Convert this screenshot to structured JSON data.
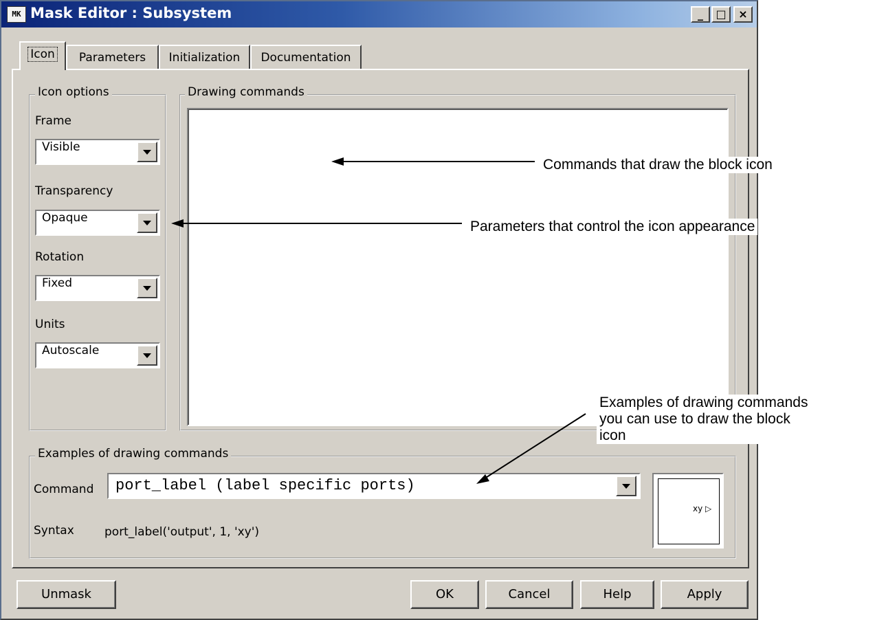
{
  "window": {
    "title": "Mask Editor : Subsystem",
    "icon_text": "MK",
    "caption_buttons": [
      "_",
      "□",
      "×"
    ]
  },
  "tabs": [
    {
      "label": "Icon",
      "active": true
    },
    {
      "label": "Parameters",
      "active": false
    },
    {
      "label": "Initialization",
      "active": false
    },
    {
      "label": "Documentation",
      "active": false
    }
  ],
  "icon_options": {
    "legend": "Icon options",
    "fields": [
      {
        "label": "Frame",
        "value": "Visible"
      },
      {
        "label": "Transparency",
        "value": "Opaque"
      },
      {
        "label": "Rotation",
        "value": "Fixed"
      },
      {
        "label": "Units",
        "value": "Autoscale"
      }
    ]
  },
  "drawing_commands": {
    "legend": "Drawing commands",
    "value": ""
  },
  "examples": {
    "legend": "Examples of drawing commands",
    "command_label": "Command",
    "command_value": "port_label (label specific ports)",
    "syntax_label": "Syntax",
    "syntax_value": "port_label('output', 1, 'xy')",
    "preview_port_label": "xy"
  },
  "buttons": {
    "unmask": "Unmask",
    "ok": "OK",
    "cancel": "Cancel",
    "help": "Help",
    "apply": "Apply"
  },
  "annotations": {
    "drawing": "Commands that draw the block icon",
    "parameters": "Parameters that control the icon appearance",
    "examples": [
      "Examples of drawing commands",
      "you can use to draw the block",
      "icon"
    ]
  }
}
